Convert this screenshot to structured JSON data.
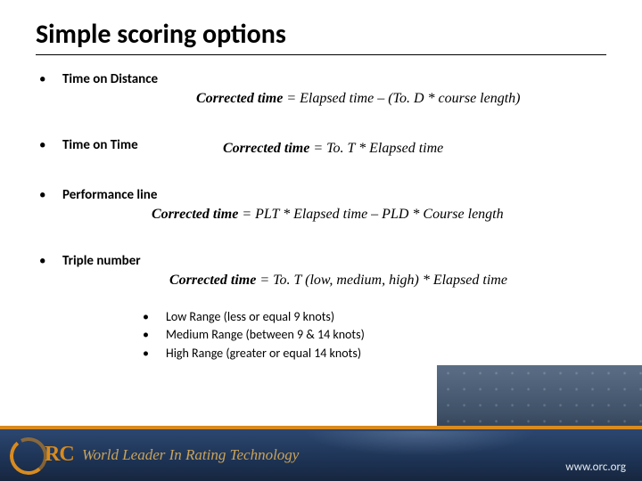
{
  "title": "Simple scoring options",
  "items": [
    {
      "label": "Time on Distance",
      "formula_lead": "Corrected time",
      "formula_rest": " = Elapsed time – (To. D * course length)"
    },
    {
      "label": "Time on Time",
      "formula_lead": "Corrected time",
      "formula_rest": " = To. T * Elapsed time"
    },
    {
      "label": "Performance line",
      "formula_lead": "Corrected time",
      "formula_rest": " = PLT * Elapsed time – PLD * Course length"
    },
    {
      "label": "Triple number",
      "formula_lead": "Corrected time",
      "formula_rest": " = To. T (low, medium, high) * Elapsed time"
    }
  ],
  "ranges": [
    "Low Range (less or equal 9 knots)",
    "Medium Range (between 9 & 14 knots)",
    "High Range (greater or equal 14 knots)"
  ],
  "footer": {
    "logo_text": "RC",
    "tagline": "World Leader In Rating Technology",
    "url": "www.orc.org"
  }
}
